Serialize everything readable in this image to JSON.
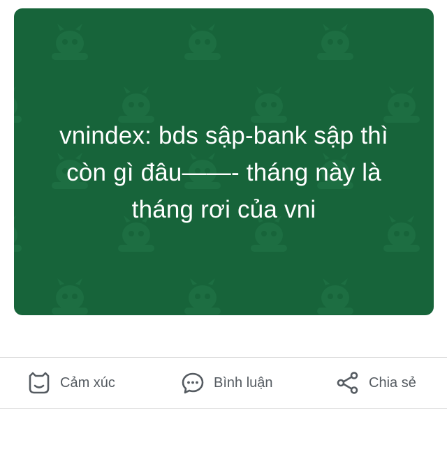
{
  "post": {
    "text": "vnindex: bds sập-bank sập thì\ncòn gì đâu——- tháng này là\ntháng rơi của vni",
    "background_color": "#17643a",
    "pattern_icon": "mascot-face-icon"
  },
  "actions": {
    "react": {
      "label": "Cảm xúc",
      "icon": "reaction-face-icon"
    },
    "comment": {
      "label": "Bình luận",
      "icon": "comment-bubble-icon"
    },
    "share": {
      "label": "Chia sẻ",
      "icon": "share-icon"
    }
  },
  "colors": {
    "action_text": "#555b61",
    "divider": "#dcdcdc"
  }
}
